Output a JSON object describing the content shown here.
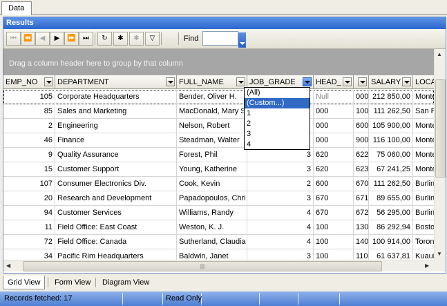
{
  "tab": {
    "label": "Data"
  },
  "results": {
    "title": "Results",
    "find_label": "Find",
    "find_value": "",
    "group_hint": "Drag a column header here to group by that column"
  },
  "navigator": [
    {
      "name": "first-record-button",
      "glyph": "⏮",
      "disabled": true
    },
    {
      "name": "prior-page-button",
      "glyph": "⏪",
      "disabled": true
    },
    {
      "name": "prior-record-button",
      "glyph": "◀",
      "disabled": true
    },
    {
      "name": "next-record-button",
      "glyph": "▶",
      "disabled": false
    },
    {
      "name": "next-page-button",
      "glyph": "⏩",
      "disabled": false
    },
    {
      "name": "last-record-button",
      "glyph": "⏭",
      "disabled": false
    },
    {
      "name": "refresh-button",
      "glyph": "↻",
      "disabled": false
    },
    {
      "name": "insert-record-button",
      "glyph": "✱",
      "disabled": false
    },
    {
      "name": "post-button",
      "glyph": "✱",
      "disabled": true
    },
    {
      "name": "filter-button",
      "glyph": "▽",
      "disabled": false
    }
  ],
  "columns": [
    "EMP_NO",
    "DEPARTMENT",
    "FULL_NAME",
    "JOB_GRADE",
    "HEAD_",
    "",
    "SALARY",
    "LOCA"
  ],
  "rows": [
    [
      "105",
      "Corporate Headquarters",
      "Bender, Oliver H.",
      "",
      "Null",
      "000",
      "212 850,00",
      "Monte"
    ],
    [
      "85",
      "Sales and Marketing",
      "MacDonald, Mary S",
      "",
      "000",
      "100",
      "111 262,50",
      "San F"
    ],
    [
      "2",
      "Engineering",
      "Nelson, Robert",
      "",
      "000",
      "600",
      "105 900,00",
      "Monte"
    ],
    [
      "46",
      "Finance",
      "Steadman, Walter",
      "",
      "000",
      "900",
      "116 100,00",
      "Monte"
    ],
    [
      "9",
      "Quality Assurance",
      "Forest, Phil",
      "3",
      "620",
      "622",
      "75 060,00",
      "Monte"
    ],
    [
      "15",
      "Customer Support",
      "Young, Katherine",
      "3",
      "620",
      "623",
      "67 241,25",
      "Monte"
    ],
    [
      "107",
      "Consumer Electronics Div.",
      "Cook, Kevin",
      "2",
      "600",
      "670",
      "111 262,50",
      "Burlin"
    ],
    [
      "20",
      "Research and Development",
      "Papadopoulos, Chri",
      "3",
      "670",
      "671",
      "89 655,00",
      "Burlin"
    ],
    [
      "94",
      "Customer Services",
      "Williams, Randy",
      "4",
      "670",
      "672",
      "56 295,00",
      "Burlin"
    ],
    [
      "11",
      "Field Office: East Coast",
      "Weston, K. J.",
      "4",
      "100",
      "130",
      "86 292,94",
      "Bosto"
    ],
    [
      "72",
      "Field Office: Canada",
      "Sutherland, Claudia",
      "4",
      "100",
      "140",
      "100 914,00",
      "Toron"
    ],
    [
      "34",
      "Pacific Rim Headquarters",
      "Baldwin, Janet",
      "3",
      "100",
      "110",
      "61 637,81",
      "Kuaui"
    ]
  ],
  "filter_dropdown": {
    "items": [
      "(All)",
      "(Custom...)",
      "1",
      "2",
      "3",
      "4"
    ],
    "selected": 1
  },
  "view_tabs": [
    "Grid View",
    "Form View",
    "Diagram View"
  ],
  "active_view": 0,
  "status": {
    "records": "Records fetched: 17",
    "mode": "Read Only"
  }
}
